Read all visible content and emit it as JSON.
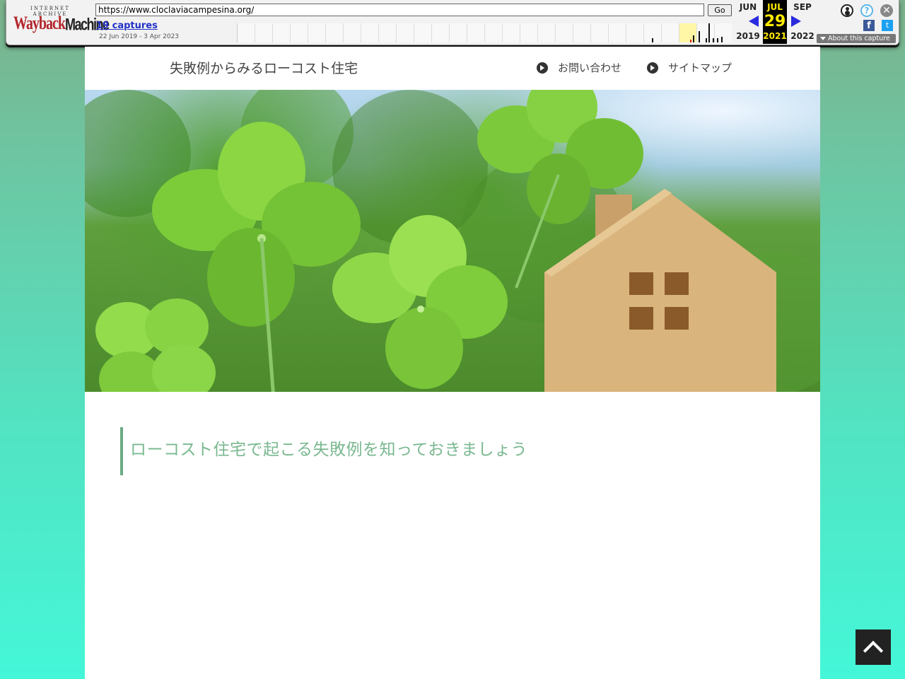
{
  "wayback": {
    "logo_top": "INTERNET ARCHIVE",
    "logo_wayback": "Wayback",
    "logo_machine": "Machine",
    "url": "https://www.cloclaviacampesina.org/",
    "go_label": "Go",
    "captures_link": "19 captures",
    "date_range": "22 Jun 2019 - 3 Apr 2023",
    "prev_month": "JUN",
    "prev_year": "2019",
    "cur_month": "JUL",
    "cur_day": "29",
    "cur_year": "2021",
    "next_month": "SEP",
    "next_year": "2022",
    "about_label": "About this capture",
    "help_glyph": "?",
    "close_glyph": "✕",
    "facebook_glyph": "f",
    "twitter_glyph": "t"
  },
  "site": {
    "title": "失敗例からみるローコスト住宅",
    "nav": [
      {
        "label": "お問い合わせ"
      },
      {
        "label": "サイトマップ"
      }
    ],
    "hero_image": "clover-and-wooden-house",
    "section_heading": "ローコスト住宅で起こる失敗例を知っておきましょう"
  },
  "colors": {
    "accent": "#6aab82",
    "heading_text": "#7ab890",
    "background_top": "#7bb08a",
    "background_bottom": "#44f7d8"
  }
}
